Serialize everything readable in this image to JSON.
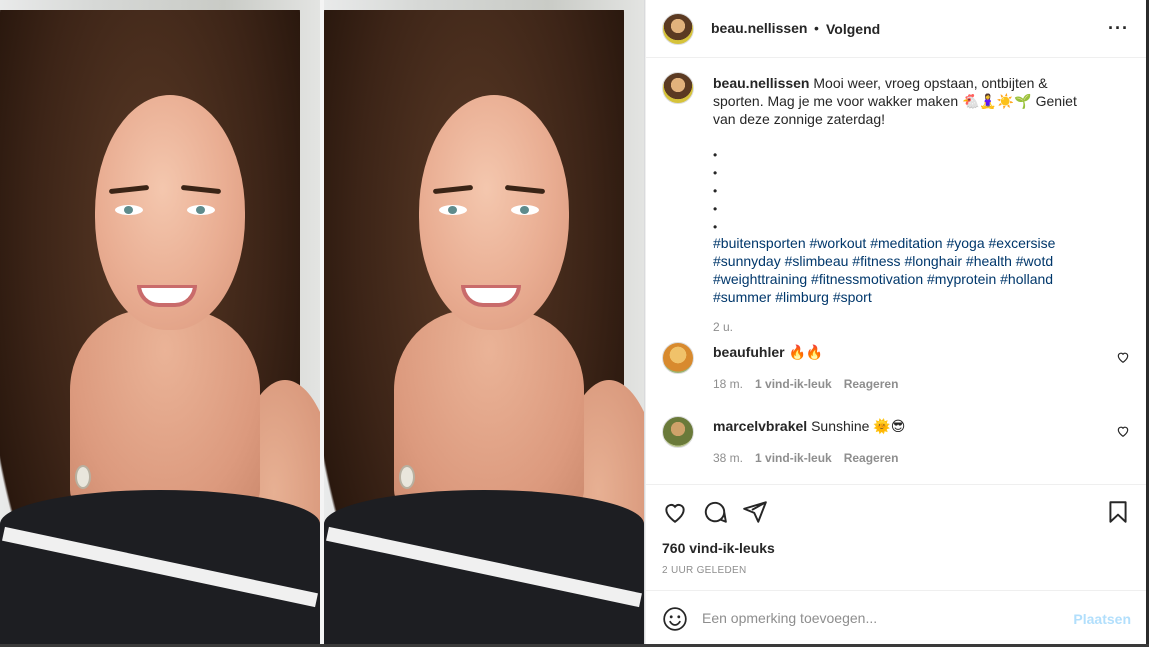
{
  "post": {
    "username": "beau.nellissen",
    "separator": "•",
    "follow_state": "Volgend",
    "more_icon": "more-horizontal-icon",
    "caption": "Mooi weer, vroeg opstaan, ontbijten & sporten. Mag je me voor wakker maken 🐔🧘‍♀️☀️🌱 Geniet van deze zonnige zaterdag!",
    "bullets": [
      "•",
      "•",
      "•",
      "•",
      "•"
    ],
    "hashtags": "#buitensporten #workout #meditation #yoga #excersise #sunnyday #slimbeau #fitness #longhair #health #wotd #weighttraining #fitnessmotivation #myprotein #holland #summer #limburg #sport",
    "caption_time": "2 u."
  },
  "comments": [
    {
      "username": "beaufuhler",
      "text": "🔥🔥",
      "time": "18 m.",
      "likes": "1 vind-ik-leuk",
      "reply": "Reageren"
    },
    {
      "username": "marcelvbrakel",
      "text": "Sunshine 🌞😎",
      "time": "38 m.",
      "likes": "1 vind-ik-leuk",
      "reply": "Reageren"
    }
  ],
  "actions": {
    "icons": [
      "heart-icon",
      "comment-icon",
      "share-icon",
      "bookmark-icon"
    ],
    "likes": "760 vind-ik-leuks",
    "time_ago": "2 UUR GELEDEN"
  },
  "add_comment": {
    "placeholder": "Een opmerking toevoegen...",
    "post_label": "Plaatsen",
    "post_color": "#b2dffc"
  },
  "colors": {
    "hashtag": "#00376b",
    "muted": "#8e8e8e",
    "text": "#262626"
  }
}
